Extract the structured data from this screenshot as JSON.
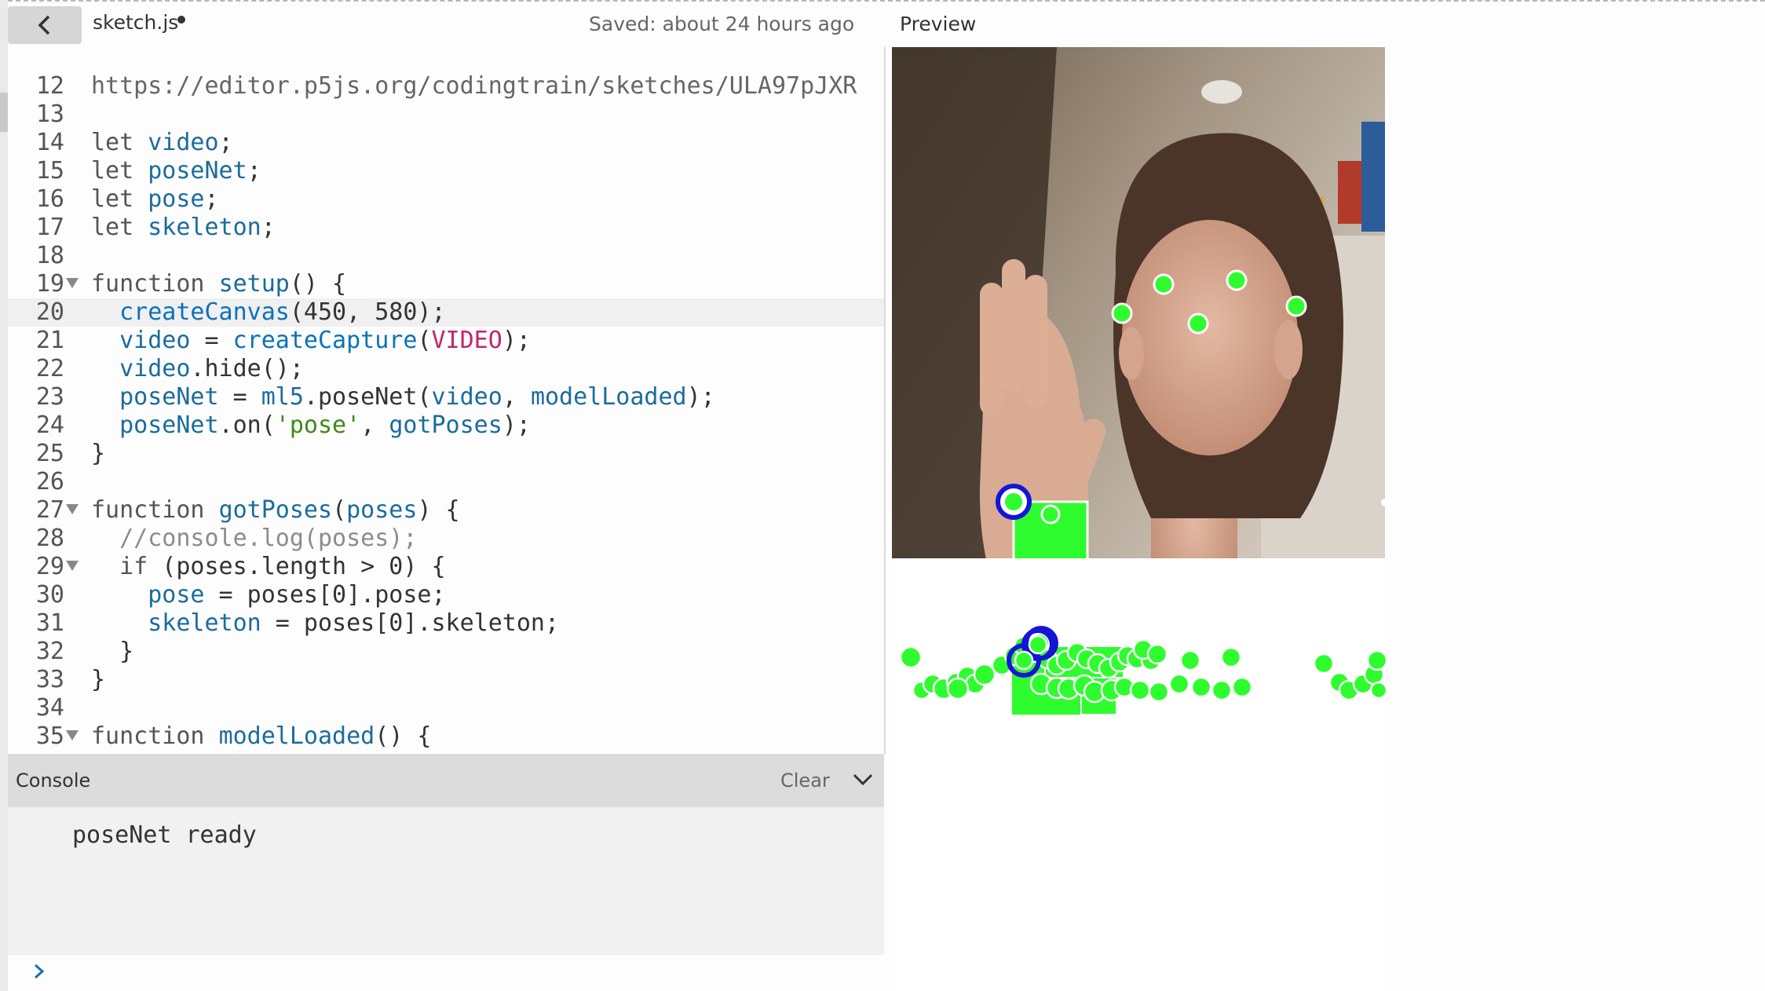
{
  "header": {
    "filename": "sketch.js",
    "saved_status": "Saved: about 24 hours ago",
    "preview_title": "Preview"
  },
  "editor": {
    "url_comment": "https://editor.p5js.org/codingtrain/sketches/ULA97pJXR",
    "line_numbers": [
      "12",
      "13",
      "14",
      "15",
      "16",
      "17",
      "18",
      "19",
      "20",
      "21",
      "22",
      "23",
      "24",
      "25",
      "26",
      "27",
      "28",
      "29",
      "30",
      "31",
      "32",
      "33",
      "34",
      "35"
    ]
  },
  "console": {
    "title": "Console",
    "clear_label": "Clear",
    "message": "poseNet ready"
  },
  "colors": {
    "keypoint": "#2efc2e",
    "wrist_ring": "#1515d8",
    "outline": "#ffffff"
  }
}
